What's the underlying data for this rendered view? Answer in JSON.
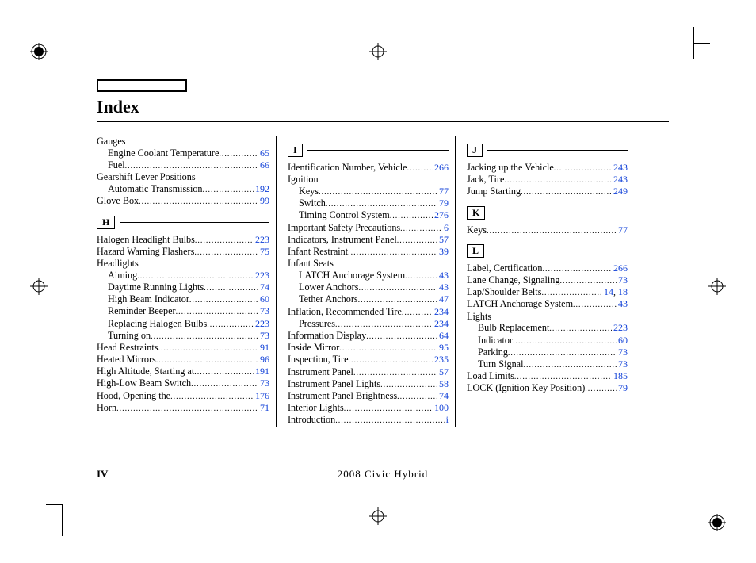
{
  "title": "Index",
  "page_label": "IV",
  "footer_text": "2008  Civic  Hybrid",
  "columns": [
    {
      "blocks": [
        {
          "type": "group",
          "heading": "Gauges",
          "items": [
            {
              "text": "Engine Coolant Temperature",
              "pages": [
                "65"
              ],
              "sub": true
            },
            {
              "text": "Fuel",
              "pages": [
                "66"
              ],
              "sub": true
            }
          ]
        },
        {
          "type": "group",
          "heading": "Gearshift Lever Positions",
          "items": [
            {
              "text": "Automatic Transmission",
              "pages": [
                "192"
              ],
              "sub": true
            }
          ]
        },
        {
          "type": "entry",
          "text": "Glove Box",
          "pages": [
            "99"
          ]
        },
        {
          "type": "letter",
          "letter": "H"
        },
        {
          "type": "entry",
          "text": "Halogen Headlight Bulbs",
          "pages": [
            "223"
          ]
        },
        {
          "type": "entry",
          "text": "Hazard Warning Flashers",
          "pages": [
            "75"
          ]
        },
        {
          "type": "group",
          "heading": "Headlights",
          "items": [
            {
              "text": "Aiming",
              "pages": [
                "223"
              ],
              "sub": true
            },
            {
              "text": "Daytime Running Lights",
              "pages": [
                "74"
              ],
              "sub": true
            },
            {
              "text": "High Beam Indicator",
              "pages": [
                "60"
              ],
              "sub": true
            },
            {
              "text": "Reminder Beeper",
              "pages": [
                "73"
              ],
              "sub": true
            },
            {
              "text": "Replacing Halogen Bulbs",
              "pages": [
                "223"
              ],
              "sub": true
            },
            {
              "text": "Turning on",
              "pages": [
                "73"
              ],
              "sub": true
            }
          ]
        },
        {
          "type": "entry",
          "text": "Head Restraints",
          "pages": [
            "91"
          ]
        },
        {
          "type": "entry",
          "text": "Heated Mirrors",
          "pages": [
            "96"
          ]
        },
        {
          "type": "entry",
          "text": "High Altitude, Starting at",
          "pages": [
            "191"
          ]
        },
        {
          "type": "entry",
          "text": "High-Low Beam Switch",
          "pages": [
            "73"
          ]
        },
        {
          "type": "entry",
          "text": "Hood, Opening the",
          "pages": [
            "176"
          ]
        },
        {
          "type": "entry",
          "text": "Horn",
          "pages": [
            "71"
          ]
        }
      ]
    },
    {
      "blocks": [
        {
          "type": "letter",
          "letter": "I"
        },
        {
          "type": "entry",
          "text": "Identification Number, Vehicle",
          "pages": [
            "266"
          ]
        },
        {
          "type": "group",
          "heading": "Ignition",
          "items": [
            {
              "text": "Keys",
              "pages": [
                "77"
              ],
              "sub": true
            },
            {
              "text": "Switch",
              "pages": [
                "79"
              ],
              "sub": true
            },
            {
              "text": "Timing Control System",
              "pages": [
                "276"
              ],
              "sub": true
            }
          ]
        },
        {
          "type": "entry",
          "text": "Important Safety Precautions",
          "pages": [
            "6"
          ]
        },
        {
          "type": "entry",
          "text": "Indicators, Instrument Panel",
          "pages": [
            "57"
          ]
        },
        {
          "type": "entry",
          "text": "Infant Restraint",
          "pages": [
            "39"
          ]
        },
        {
          "type": "group",
          "heading": "Infant Seats",
          "items": [
            {
              "text": "LATCH Anchorage System",
              "pages": [
                "43"
              ],
              "sub": true
            },
            {
              "text": "Lower Anchors",
              "pages": [
                "43"
              ],
              "sub": true
            },
            {
              "text": "Tether Anchors",
              "pages": [
                "47"
              ],
              "sub": true
            }
          ]
        },
        {
          "type": "entry",
          "text": "Inflation, Recommended Tire",
          "pages": [
            "234"
          ]
        },
        {
          "type": "entry",
          "text": "Pressures",
          "pages": [
            "234"
          ],
          "sub": true
        },
        {
          "type": "entry",
          "text": "Information Display",
          "pages": [
            "64"
          ]
        },
        {
          "type": "entry",
          "text": "Inside Mirror",
          "pages": [
            "95"
          ]
        },
        {
          "type": "entry",
          "text": "Inspection, Tire",
          "pages": [
            "235"
          ]
        },
        {
          "type": "entry",
          "text": "Instrument Panel",
          "pages": [
            "57"
          ]
        },
        {
          "type": "entry",
          "text": "Instrument Panel Lights",
          "pages": [
            "58"
          ]
        },
        {
          "type": "entry",
          "text": "Instrument Panel Brightness",
          "pages": [
            "74"
          ]
        },
        {
          "type": "entry",
          "text": "Interior Lights",
          "pages": [
            "100"
          ]
        },
        {
          "type": "entry",
          "text": "Introduction",
          "pages": [
            "i"
          ]
        }
      ]
    },
    {
      "blocks": [
        {
          "type": "letter",
          "letter": "J"
        },
        {
          "type": "entry",
          "text": "Jacking up the Vehicle",
          "pages": [
            "243"
          ]
        },
        {
          "type": "entry",
          "text": "Jack, Tire",
          "pages": [
            "243"
          ]
        },
        {
          "type": "entry",
          "text": "Jump Starting",
          "pages": [
            "249"
          ]
        },
        {
          "type": "letter",
          "letter": "K"
        },
        {
          "type": "entry",
          "text": "Keys",
          "pages": [
            "77"
          ]
        },
        {
          "type": "letter",
          "letter": "L"
        },
        {
          "type": "entry",
          "text": "Label, Certification",
          "pages": [
            "266"
          ]
        },
        {
          "type": "entry",
          "text": "Lane Change, Signaling",
          "pages": [
            "73"
          ]
        },
        {
          "type": "entry",
          "text": "Lap/Shoulder Belts",
          "pages": [
            "14",
            "18"
          ]
        },
        {
          "type": "entry",
          "text": "LATCH Anchorage System",
          "pages": [
            "43"
          ]
        },
        {
          "type": "group",
          "heading": "Lights",
          "items": [
            {
              "text": "Bulb Replacement",
              "pages": [
                "223"
              ],
              "sub": true
            },
            {
              "text": "Indicator",
              "pages": [
                "60"
              ],
              "sub": true
            },
            {
              "text": "Parking",
              "pages": [
                "73"
              ],
              "sub": true
            },
            {
              "text": "Turn Signal",
              "pages": [
                "73"
              ],
              "sub": true
            }
          ]
        },
        {
          "type": "entry",
          "text": "Load Limits",
          "pages": [
            "185"
          ]
        },
        {
          "type": "entry",
          "text": "LOCK (Ignition Key Position)",
          "pages": [
            "79"
          ]
        }
      ]
    }
  ]
}
